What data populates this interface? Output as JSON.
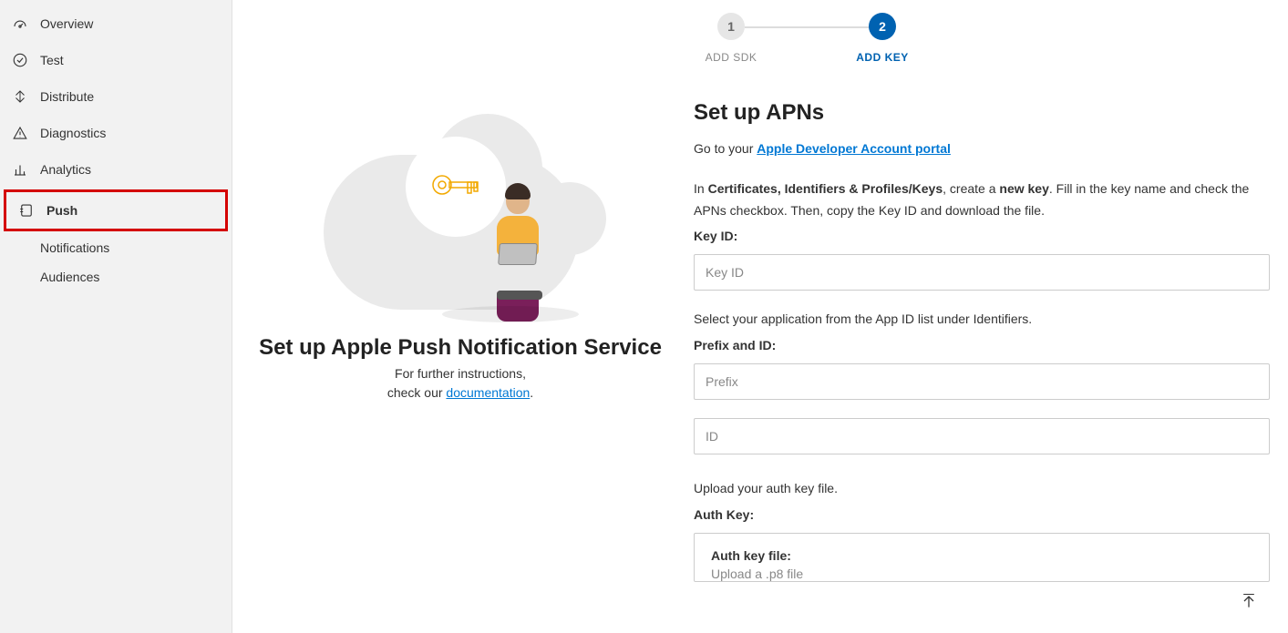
{
  "sidebar": {
    "items": [
      {
        "label": "Overview",
        "icon": "gauge-icon"
      },
      {
        "label": "Test",
        "icon": "check-circle-icon"
      },
      {
        "label": "Distribute",
        "icon": "distribute-icon"
      },
      {
        "label": "Diagnostics",
        "icon": "warning-icon"
      },
      {
        "label": "Analytics",
        "icon": "bar-chart-icon"
      },
      {
        "label": "Push",
        "icon": "push-icon",
        "active": true,
        "highlighted": true
      }
    ],
    "subitems": [
      {
        "label": "Notifications"
      },
      {
        "label": "Audiences"
      }
    ]
  },
  "stepper": {
    "steps": [
      {
        "num": "1",
        "label": "ADD SDK",
        "state": "inactive"
      },
      {
        "num": "2",
        "label": "ADD KEY",
        "state": "active"
      }
    ]
  },
  "leftPanel": {
    "title": "Set up Apple Push Notification Service",
    "sub1": "For further instructions,",
    "sub2_pre": "check our ",
    "sub2_link": "documentation",
    "sub2_post": "."
  },
  "form": {
    "heading": "Set up APNs",
    "intro_pre": "Go to your ",
    "intro_link": "Apple Developer Account portal",
    "instr_1": "In ",
    "instr_bold1": "Certificates, Identifiers & Profiles/Keys",
    "instr_2": ", create a ",
    "instr_bold2": "new key",
    "instr_3": ". Fill in the key name and check the APNs checkbox. Then, copy the Key ID and download the file.",
    "keyid_label": "Key ID:",
    "keyid_placeholder": "Key ID",
    "appid_text": "Select your application from the App ID list under Identifiers.",
    "prefixid_label": "Prefix and ID:",
    "prefix_placeholder": "Prefix",
    "id_placeholder": "ID",
    "upload_text": "Upload your auth key file.",
    "authkey_label": "Auth Key:",
    "upload_box_title": "Auth key file:",
    "upload_box_sub": "Upload a .p8 file"
  }
}
